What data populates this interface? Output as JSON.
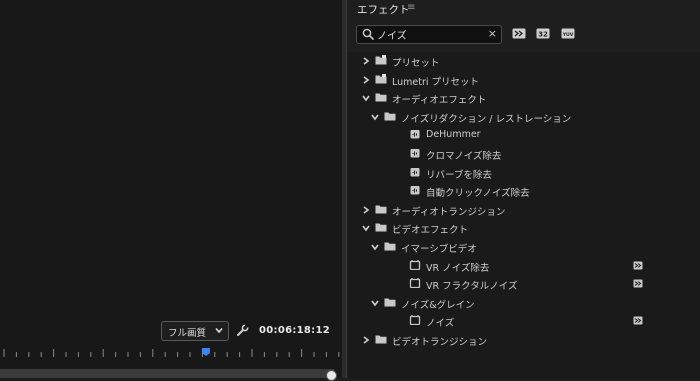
{
  "panel": {
    "title": "エフェクト",
    "menu_icon": "≡"
  },
  "search": {
    "value": "ノイズ",
    "clear_label": "×",
    "placeholder": ""
  },
  "toolbar": {
    "buttons": [
      "accelerated-effects-icon",
      "32bit-icon",
      "yuv-icon"
    ],
    "label_32": "32",
    "label_yuv": "YUV"
  },
  "tree": [
    {
      "label": "プリセット",
      "level": 0,
      "expanded": false,
      "icon": "preset-folder-icon"
    },
    {
      "label": "Lumetri プリセット",
      "level": 0,
      "expanded": false,
      "icon": "preset-folder-icon"
    },
    {
      "label": "オーディオエフェクト",
      "level": 0,
      "expanded": true,
      "icon": "folder-icon"
    },
    {
      "label": "ノイズリダクション / レストレーション",
      "level": 1,
      "expanded": true,
      "icon": "folder-icon"
    },
    {
      "label": "DeHummer",
      "level": 2,
      "icon": "audio-effect-icon"
    },
    {
      "label": "クロマノイズ除去",
      "level": 2,
      "icon": "audio-effect-icon"
    },
    {
      "label": "リバーブを除去",
      "level": 2,
      "icon": "audio-effect-icon"
    },
    {
      "label": "自動クリックノイズ除去",
      "level": 2,
      "icon": "audio-effect-icon"
    },
    {
      "label": "オーディオトランジション",
      "level": 0,
      "expanded": false,
      "icon": "folder-icon"
    },
    {
      "label": "ビデオエフェクト",
      "level": 0,
      "expanded": true,
      "icon": "folder-icon"
    },
    {
      "label": "イマーシブビデオ",
      "level": 1,
      "expanded": true,
      "icon": "folder-icon"
    },
    {
      "label": "VR ノイズ除去",
      "level": 2,
      "icon": "video-effect-icon",
      "badge": "accelerated-icon"
    },
    {
      "label": "VR フラクタルノイズ",
      "level": 2,
      "icon": "video-effect-icon",
      "badge": "accelerated-icon"
    },
    {
      "label": "ノイズ&グレイン",
      "level": 1,
      "expanded": true,
      "icon": "folder-icon"
    },
    {
      "label": "ノイズ",
      "level": 2,
      "icon": "video-effect-icon",
      "badge": "accelerated-icon"
    },
    {
      "label": "ビデオトランジション",
      "level": 0,
      "expanded": false,
      "icon": "folder-icon"
    }
  ],
  "monitor": {
    "quality": "フル画質",
    "timecode": "00:06:18:12"
  },
  "colors": {
    "accent": "#3b82f6",
    "panel_bg": "#1e1e1e",
    "text": "#cfcfcf"
  }
}
